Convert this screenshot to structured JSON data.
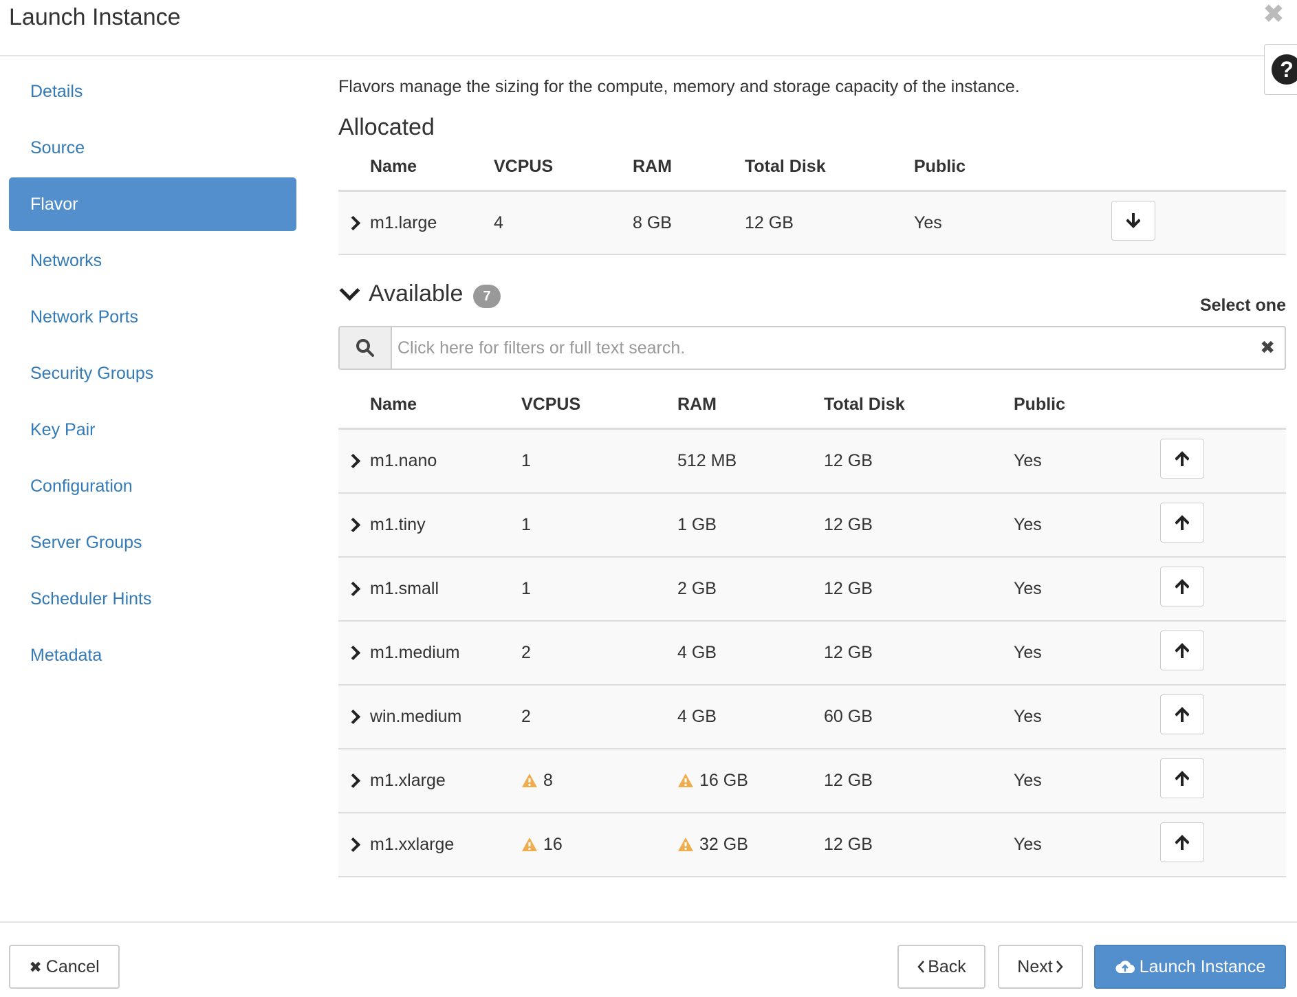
{
  "dialog": {
    "title": "Launch Instance",
    "close_icon": "close-icon",
    "help_label": "?"
  },
  "sidebar": {
    "items": [
      {
        "label": "Details",
        "active": false
      },
      {
        "label": "Source",
        "active": false
      },
      {
        "label": "Flavor",
        "active": true
      },
      {
        "label": "Networks",
        "active": false
      },
      {
        "label": "Network Ports",
        "active": false
      },
      {
        "label": "Security Groups",
        "active": false
      },
      {
        "label": "Key Pair",
        "active": false
      },
      {
        "label": "Configuration",
        "active": false
      },
      {
        "label": "Server Groups",
        "active": false
      },
      {
        "label": "Scheduler Hints",
        "active": false
      },
      {
        "label": "Metadata",
        "active": false
      }
    ]
  },
  "main": {
    "description": "Flavors manage the sizing for the compute, memory and storage capacity of the instance.",
    "allocated": {
      "title": "Allocated",
      "columns": [
        "Name",
        "VCPUS",
        "RAM",
        "Total Disk",
        "Public"
      ],
      "rows": [
        {
          "name": "m1.large",
          "vcpus": "4",
          "ram": "8 GB",
          "disk": "12 GB",
          "public": "Yes"
        }
      ]
    },
    "available": {
      "title": "Available",
      "count": "7",
      "select_hint": "Select one",
      "search_placeholder": "Click here for filters or full text search.",
      "search_clear": "✖",
      "columns": [
        "Name",
        "VCPUS",
        "RAM",
        "Total Disk",
        "Public"
      ],
      "rows": [
        {
          "name": "m1.nano",
          "vcpus": "1",
          "ram": "512 MB",
          "disk": "12 GB",
          "public": "Yes",
          "vcpus_warn": false,
          "ram_warn": false
        },
        {
          "name": "m1.tiny",
          "vcpus": "1",
          "ram": "1 GB",
          "disk": "12 GB",
          "public": "Yes",
          "vcpus_warn": false,
          "ram_warn": false
        },
        {
          "name": "m1.small",
          "vcpus": "1",
          "ram": "2 GB",
          "disk": "12 GB",
          "public": "Yes",
          "vcpus_warn": false,
          "ram_warn": false
        },
        {
          "name": "m1.medium",
          "vcpus": "2",
          "ram": "4 GB",
          "disk": "12 GB",
          "public": "Yes",
          "vcpus_warn": false,
          "ram_warn": false
        },
        {
          "name": "win.medium",
          "vcpus": "2",
          "ram": "4 GB",
          "disk": "60 GB",
          "public": "Yes",
          "vcpus_warn": false,
          "ram_warn": false
        },
        {
          "name": "m1.xlarge",
          "vcpus": "8",
          "ram": "16 GB",
          "disk": "12 GB",
          "public": "Yes",
          "vcpus_warn": true,
          "ram_warn": true
        },
        {
          "name": "m1.xxlarge",
          "vcpus": "16",
          "ram": "32 GB",
          "disk": "12 GB",
          "public": "Yes",
          "vcpus_warn": true,
          "ram_warn": true
        }
      ]
    }
  },
  "footer": {
    "cancel_label": "Cancel",
    "cancel_icon": "✖",
    "back_label": "Back",
    "next_label": "Next",
    "launch_label": "Launch Instance"
  },
  "colors": {
    "accent": "#528fcc",
    "link": "#337ab7",
    "warning": "#f0ad4e",
    "badge": "#999999"
  }
}
